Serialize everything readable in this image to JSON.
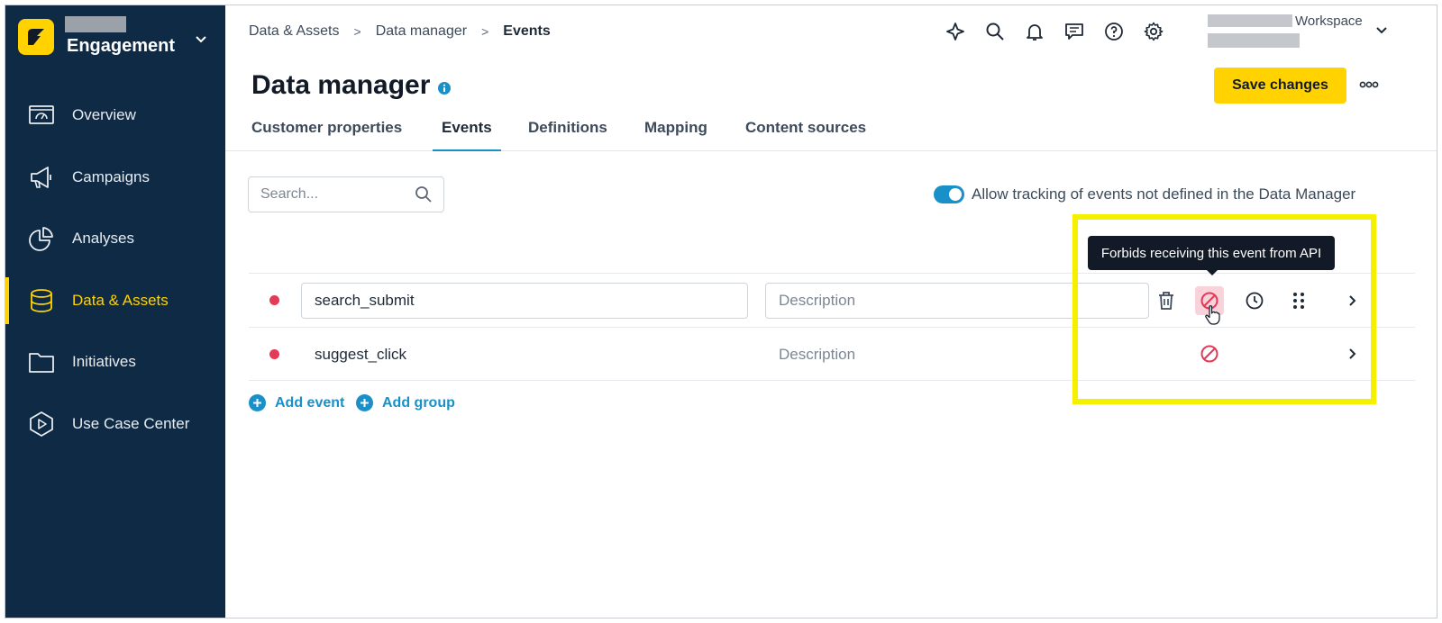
{
  "sidebar": {
    "brand_name": "Engagement",
    "items": [
      {
        "label": "Overview",
        "icon": "overview-icon"
      },
      {
        "label": "Campaigns",
        "icon": "megaphone-icon"
      },
      {
        "label": "Analyses",
        "icon": "pie-chart-icon"
      },
      {
        "label": "Data & Assets",
        "icon": "database-icon",
        "active": true
      },
      {
        "label": "Initiatives",
        "icon": "folder-icon"
      },
      {
        "label": "Use Case Center",
        "icon": "play-hexagon-icon"
      }
    ]
  },
  "header": {
    "breadcrumb": [
      "Data & Assets",
      "Data manager",
      "Events"
    ],
    "workspace_label": "Workspace",
    "icons": [
      "sparkle-icon",
      "search-icon",
      "bell-icon",
      "chat-icon",
      "help-icon",
      "gear-icon"
    ]
  },
  "page": {
    "title": "Data manager",
    "save_label": "Save changes",
    "tabs": [
      "Customer properties",
      "Events",
      "Definitions",
      "Mapping",
      "Content sources"
    ],
    "active_tab": "Events"
  },
  "controls": {
    "search_placeholder": "Search...",
    "toggle_label": "Allow tracking of events not defined in the Data Manager",
    "toggle_on": true
  },
  "events": [
    {
      "name": "search_submit",
      "description_placeholder": "Description",
      "editing": true
    },
    {
      "name": "suggest_click",
      "description_placeholder": "Description",
      "editing": false
    }
  ],
  "actions": {
    "add_event": "Add event",
    "add_group": "Add group",
    "tooltip": "Forbids receiving this event from API"
  },
  "colors": {
    "sidebar_bg": "#0f2a44",
    "accent_yellow": "#ffd200",
    "accent_blue": "#1a90c8",
    "status_red": "#e23a57",
    "highlight": "#f5f000"
  }
}
